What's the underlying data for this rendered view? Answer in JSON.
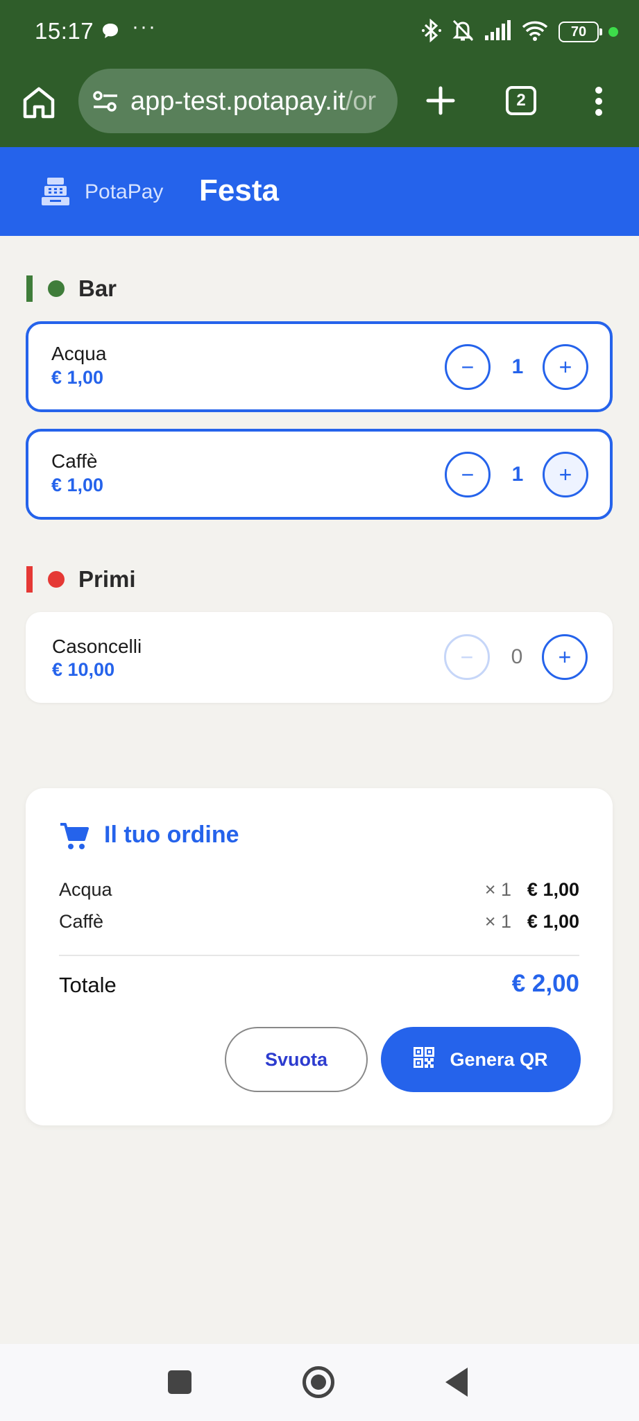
{
  "status_bar": {
    "time": "15:17",
    "dots": "···",
    "battery": "70"
  },
  "browser": {
    "url_main": "app-test.potapay.it",
    "url_rest": "/or",
    "tab_count": "2"
  },
  "header": {
    "brand": "PotaPay",
    "title": "Festa"
  },
  "sections": [
    {
      "name": "Bar",
      "color": "#3f7d3a",
      "items": [
        {
          "name": "Acqua",
          "price": "€ 1,00",
          "qty": "1"
        },
        {
          "name": "Caffè",
          "price": "€ 1,00",
          "qty": "1"
        }
      ]
    },
    {
      "name": "Primi",
      "color": "#e53935",
      "items": [
        {
          "name": "Casoncelli",
          "price": "€ 10,00",
          "qty": "0"
        }
      ]
    }
  ],
  "stepper": {
    "minus": "−",
    "plus": "+"
  },
  "order": {
    "title": "Il tuo ordine",
    "lines": [
      {
        "name": "Acqua",
        "qty": "× 1",
        "price": "€ 1,00"
      },
      {
        "name": "Caffè",
        "qty": "× 1",
        "price": "€ 1,00"
      }
    ],
    "total_label": "Totale",
    "total_value": "€ 2,00",
    "clear_label": "Svuota",
    "qr_label": "Genera QR"
  },
  "colors": {
    "primary": "#2563eb",
    "browser_green": "#2f5d2a"
  }
}
